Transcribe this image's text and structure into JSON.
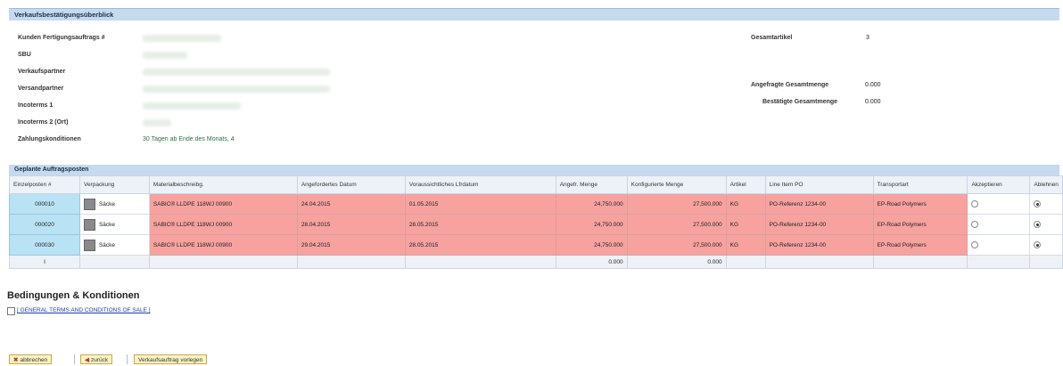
{
  "panel": {
    "title": "Verkaufsbestätigungsüberblick"
  },
  "fields": {
    "kunden_label": "Kunden Fertigungsauftrags #",
    "sbu_label": "SBU",
    "verkaufspartner_label": "Verkaufspartner",
    "versandpartner_label": "Versandpartner",
    "incoterms1_label": "Incoterms 1",
    "incoterms2_label": "Incoterms 2 (Ort)",
    "zahlung_label": "Zahlungskonditionen",
    "zahlung_value": "30 Tagen ab Ende des Monats, 4",
    "gesamtartikel_label": "Gesamtartikel",
    "gesamtartikel_value": "3",
    "angefragte_label": "Angefragte Gesamtmenge",
    "angefragte_value": "0.000",
    "bestaetigte_label": "Bestätigte Gesamtmenge",
    "bestaetigte_value": "0.000"
  },
  "section": {
    "title": "Geplante Auftragsposten"
  },
  "table": {
    "headers": [
      "Einzelposten #",
      "Verpackung",
      "Materialbeschreibg.",
      "Angefordertes Datum",
      "Voraussichtliches Lfrdatum",
      "Angefr. Menge",
      "Konfigurierte Menge",
      "Artikel",
      "Line Item PO",
      "Transportart",
      "Akzeptieren",
      "Ablehnen"
    ],
    "rows": [
      {
        "pos": "000010",
        "pack": "Säcke",
        "mat": "SABIC® LLDPE 118WJ 00900",
        "req": "24.04.2015",
        "eta": "01.05.2015",
        "qty": "24,750.000",
        "conf": "27,500.000",
        "unit": "KG",
        "po": "PO-Referenz 1234-00",
        "trans": "EP-Road Polymers"
      },
      {
        "pos": "000020",
        "pack": "Säcke",
        "mat": "SABIC® LLDPE 118WJ 00900",
        "req": "28.04.2015",
        "eta": "28.05.2015",
        "qty": "24,750.000",
        "conf": "27,500.000",
        "unit": "KG",
        "po": "PO-Referenz 1234-00",
        "trans": "EP-Road Polymers"
      },
      {
        "pos": "000030",
        "pack": "Säcke",
        "mat": "SABIC® LLDPE 118WJ 00900",
        "req": "29.04.2015",
        "eta": "28.05.2015",
        "qty": "24,750.000",
        "conf": "27,500.000",
        "unit": "KG",
        "po": "PO-Referenz 1234-00",
        "trans": "EP-Road Polymers"
      }
    ],
    "footer": {
      "cursor": "I",
      "qty": "0.000",
      "conf": "0.000"
    }
  },
  "terms": {
    "heading": "Bedingungen & Konditionen",
    "link": "[ GENERAL TERMS AND CONDITIONS OF SALE ]"
  },
  "buttons": {
    "cancel": "abbrechen",
    "back": "zurück",
    "submit": "Verkaufsauftrag vorlegen"
  },
  "colors": {
    "header_bar": "#c5d9ef",
    "row_red": "#f7a29f",
    "pos_blue": "#b9e3f5",
    "button_yellow": "#fbf3c4"
  }
}
